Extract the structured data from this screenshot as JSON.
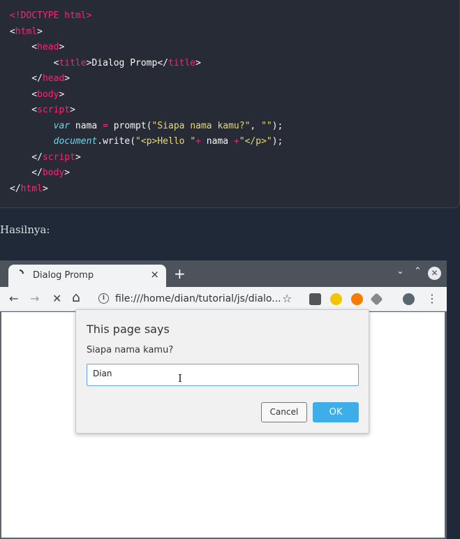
{
  "code": {
    "lines": [
      [
        {
          "t": "<!DOCTYPE html>",
          "c": "pink"
        }
      ],
      [
        {
          "t": "<",
          "c": "white"
        },
        {
          "t": "html",
          "c": "pink"
        },
        {
          "t": ">",
          "c": "white"
        }
      ],
      [
        {
          "t": "    <",
          "c": "white"
        },
        {
          "t": "head",
          "c": "pink"
        },
        {
          "t": ">",
          "c": "white"
        }
      ],
      [
        {
          "t": "        <",
          "c": "white"
        },
        {
          "t": "title",
          "c": "pink"
        },
        {
          "t": ">Dialog Promp</",
          "c": "white"
        },
        {
          "t": "title",
          "c": "pink"
        },
        {
          "t": ">",
          "c": "white"
        }
      ],
      [
        {
          "t": "    </",
          "c": "white"
        },
        {
          "t": "head",
          "c": "pink"
        },
        {
          "t": ">",
          "c": "white"
        }
      ],
      [
        {
          "t": "    <",
          "c": "white"
        },
        {
          "t": "body",
          "c": "pink"
        },
        {
          "t": ">",
          "c": "white"
        }
      ],
      [
        {
          "t": "    <",
          "c": "white"
        },
        {
          "t": "script",
          "c": "pink"
        },
        {
          "t": ">",
          "c": "white"
        }
      ],
      [
        {
          "t": "        ",
          "c": "white"
        },
        {
          "t": "var",
          "c": "cyan"
        },
        {
          "t": " nama ",
          "c": "white"
        },
        {
          "t": "=",
          "c": "pink"
        },
        {
          "t": " prompt(",
          "c": "white"
        },
        {
          "t": "\"Siapa nama kamu?\"",
          "c": "yellow"
        },
        {
          "t": ", ",
          "c": "white"
        },
        {
          "t": "\"\"",
          "c": "yellow"
        },
        {
          "t": ");",
          "c": "white"
        }
      ],
      [
        {
          "t": "        ",
          "c": "white"
        },
        {
          "t": "document",
          "c": "cyan"
        },
        {
          "t": ".write(",
          "c": "white"
        },
        {
          "t": "\"<p>Hello \"",
          "c": "yellow"
        },
        {
          "t": "+",
          "c": "pink"
        },
        {
          "t": " nama ",
          "c": "white"
        },
        {
          "t": "+",
          "c": "pink"
        },
        {
          "t": "\"</p>\"",
          "c": "yellow"
        },
        {
          "t": ");",
          "c": "white"
        }
      ],
      [
        {
          "t": "    </",
          "c": "white"
        },
        {
          "t": "script",
          "c": "pink"
        },
        {
          "t": ">",
          "c": "white"
        }
      ],
      [
        {
          "t": "    </",
          "c": "white"
        },
        {
          "t": "body",
          "c": "pink"
        },
        {
          "t": ">",
          "c": "white"
        }
      ],
      [
        {
          "t": "</",
          "c": "white"
        },
        {
          "t": "html",
          "c": "pink"
        },
        {
          "t": ">",
          "c": "white"
        }
      ]
    ]
  },
  "hasil_label": "Hasilnya:",
  "browser": {
    "tab_title": "Dialog Promp",
    "tab_close": "×",
    "new_tab": "+",
    "url": "file:///home/dian/tutorial/js/dialo...",
    "win_minimize": "⌄",
    "win_maximize": "⌃",
    "win_close": "✕",
    "nav": {
      "back": "←",
      "forward": "→",
      "stop": "✕",
      "home": "⌂",
      "star": "☆",
      "menu": "⋮"
    }
  },
  "dialog": {
    "title": "This page says",
    "message": "Siapa nama kamu?",
    "input_value": "Dian",
    "cancel_label": "Cancel",
    "ok_label": "OK"
  },
  "colors": {
    "ok_button": "#3daee9",
    "page_bg": "#1f2937",
    "code_bg": "#272b35"
  }
}
